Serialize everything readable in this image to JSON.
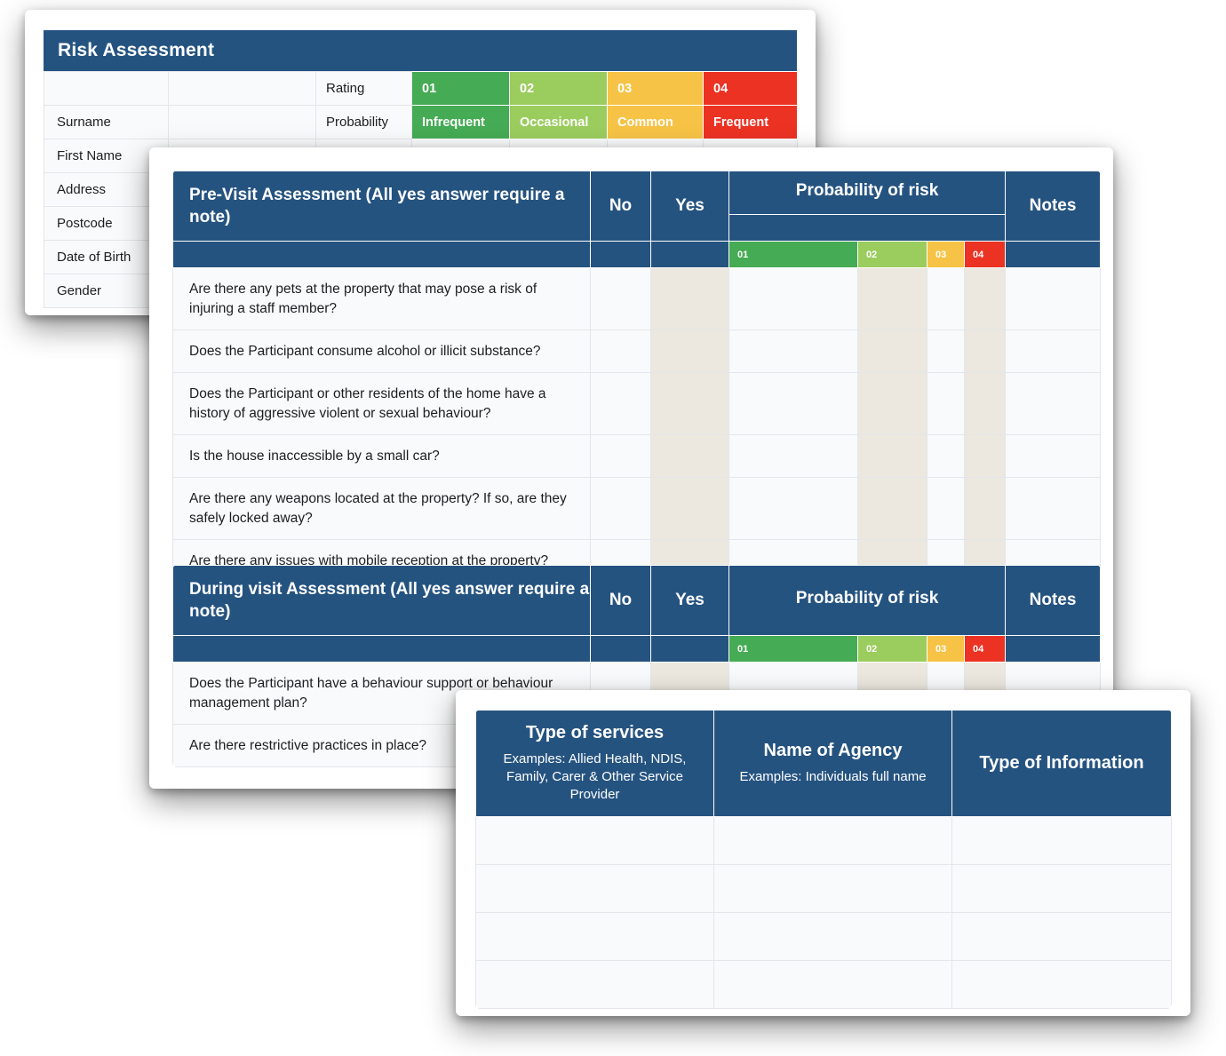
{
  "colors": {
    "header_blue": "#255380",
    "rating_01": "#45ab54",
    "rating_02": "#9bcc5e",
    "rating_03": "#f6c346",
    "rating_04": "#eb3223",
    "tinted_column": "#ece8df",
    "cell_background": "#f9fafb"
  },
  "risk_card": {
    "title": "Risk Assessment",
    "fields": [
      "Surname",
      "First Name",
      "Address",
      "Postcode",
      "Date of Birth",
      "Gender"
    ],
    "rating_row_label": "Rating",
    "probability_row_label": "Probability",
    "ratings": [
      "01",
      "02",
      "03",
      "04"
    ],
    "probabilities": [
      "Infrequent",
      "Occasional",
      "Common",
      "Frequent"
    ]
  },
  "visit_card": {
    "sections": [
      {
        "title": "Pre-Visit Assessment (All yes answer require a note)",
        "columns": {
          "no": "No",
          "yes": "Yes",
          "probability": "Probability of risk",
          "notes": "Notes"
        },
        "probability_levels": [
          "01",
          "02",
          "03",
          "04"
        ],
        "questions": [
          "Are there any pets at the property that may pose a risk of injuring a staff member?",
          "Does the Participant consume alcohol or illicit substance?",
          "Does the Participant or other residents of the home have a history of aggressive violent or sexual behaviour?",
          "Is the house inaccessible by a small car?",
          "Are there any weapons located at the property? If so, are they safely locked away?",
          "Are there any issues with mobile reception at the property?"
        ]
      },
      {
        "title": "During visit Assessment (All yes answer require a note)",
        "columns": {
          "no": "No",
          "yes": "Yes",
          "probability": "Probability of risk",
          "notes": "Notes"
        },
        "probability_levels": [
          "01",
          "02",
          "03",
          "04"
        ],
        "questions": [
          "Does the Participant have a behaviour support or behaviour management plan?",
          "Are there restrictive practices in place?"
        ]
      }
    ]
  },
  "agency_card": {
    "columns": [
      {
        "title": "Type of services",
        "subtitle": "Examples: Allied Health, NDIS, Family, Carer & Other Service Provider"
      },
      {
        "title": "Name of Agency",
        "subtitle": "Examples: Individuals full name"
      },
      {
        "title": "Type of Information",
        "subtitle": ""
      }
    ],
    "empty_row_count": 4
  }
}
